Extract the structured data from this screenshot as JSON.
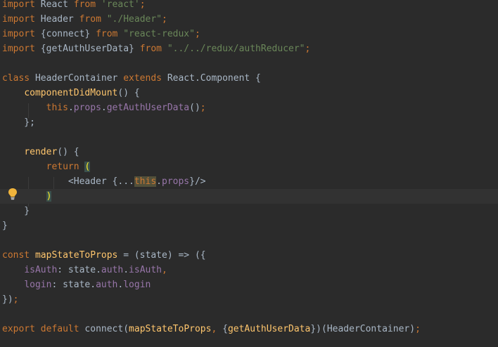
{
  "editor": {
    "lines": [
      [
        {
          "t": "import ",
          "c": "kw"
        },
        {
          "t": "React ",
          "c": "plain"
        },
        {
          "t": "from ",
          "c": "kw"
        },
        {
          "t": "'react'",
          "c": "str"
        },
        {
          "t": ";",
          "c": "kw"
        }
      ],
      [
        {
          "t": "import ",
          "c": "kw"
        },
        {
          "t": "Header ",
          "c": "plain"
        },
        {
          "t": "from ",
          "c": "kw"
        },
        {
          "t": "\"./Header\"",
          "c": "str"
        },
        {
          "t": ";",
          "c": "kw"
        }
      ],
      [
        {
          "t": "import ",
          "c": "kw"
        },
        {
          "t": "{connect} ",
          "c": "plain"
        },
        {
          "t": "from ",
          "c": "kw"
        },
        {
          "t": "\"react-redux\"",
          "c": "str"
        },
        {
          "t": ";",
          "c": "kw"
        }
      ],
      [
        {
          "t": "import ",
          "c": "kw"
        },
        {
          "t": "{getAuthUserData} ",
          "c": "plain"
        },
        {
          "t": "from ",
          "c": "kw"
        },
        {
          "t": "\"../../redux/authReducer\"",
          "c": "str"
        },
        {
          "t": ";",
          "c": "kw"
        }
      ],
      [],
      [
        {
          "t": "class ",
          "c": "kw"
        },
        {
          "t": "HeaderContainer ",
          "c": "plain"
        },
        {
          "t": "extends ",
          "c": "kw"
        },
        {
          "t": "React.Component {",
          "c": "plain"
        }
      ],
      [
        {
          "t": "    ",
          "c": "plain"
        },
        {
          "t": "componentDidMount",
          "c": "fn"
        },
        {
          "t": "() {",
          "c": "plain"
        }
      ],
      [
        {
          "t": "        ",
          "c": "plain"
        },
        {
          "t": "this",
          "c": "kw"
        },
        {
          "t": ".",
          "c": "plain"
        },
        {
          "t": "props",
          "c": "prop"
        },
        {
          "t": ".",
          "c": "plain"
        },
        {
          "t": "getAuthUserData",
          "c": "prop"
        },
        {
          "t": "()",
          "c": "plain"
        },
        {
          "t": ";",
          "c": "kw"
        }
      ],
      [
        {
          "t": "    };",
          "c": "plain"
        }
      ],
      [],
      [
        {
          "t": "    ",
          "c": "plain"
        },
        {
          "t": "render",
          "c": "fn"
        },
        {
          "t": "() {",
          "c": "plain"
        }
      ],
      [
        {
          "t": "        ",
          "c": "plain"
        },
        {
          "t": "return ",
          "c": "kw"
        },
        {
          "t": "(",
          "c": "brace-match"
        }
      ],
      [
        {
          "t": "            ",
          "c": "plain"
        },
        {
          "t": "<",
          "c": "plain"
        },
        {
          "t": "Header ",
          "c": "plain"
        },
        {
          "t": "{...",
          "c": "plain"
        },
        {
          "t": "this",
          "c": "kw this-hl"
        },
        {
          "t": ".",
          "c": "plain"
        },
        {
          "t": "props",
          "c": "prop"
        },
        {
          "t": "}/>",
          "c": "plain"
        }
      ],
      [
        {
          "t": "        ",
          "c": "plain"
        },
        {
          "t": ")",
          "c": "brace-match"
        }
      ],
      [
        {
          "t": "    }",
          "c": "plain"
        }
      ],
      [
        {
          "t": "}",
          "c": "plain"
        }
      ],
      [],
      [
        {
          "t": "const ",
          "c": "kw"
        },
        {
          "t": "mapStateToProps",
          "c": "fn"
        },
        {
          "t": " = (state) => ({",
          "c": "plain"
        }
      ],
      [
        {
          "t": "    ",
          "c": "plain"
        },
        {
          "t": "isAuth",
          "c": "prop"
        },
        {
          "t": ": state.",
          "c": "plain"
        },
        {
          "t": "auth",
          "c": "prop"
        },
        {
          "t": ".",
          "c": "plain"
        },
        {
          "t": "isAuth",
          "c": "prop"
        },
        {
          "t": ",",
          "c": "kw"
        }
      ],
      [
        {
          "t": "    ",
          "c": "plain"
        },
        {
          "t": "login",
          "c": "prop"
        },
        {
          "t": ": state.",
          "c": "plain"
        },
        {
          "t": "auth",
          "c": "prop"
        },
        {
          "t": ".",
          "c": "plain"
        },
        {
          "t": "login",
          "c": "prop"
        }
      ],
      [
        {
          "t": "})",
          "c": "plain"
        },
        {
          "t": ";",
          "c": "kw"
        }
      ],
      [],
      [
        {
          "t": "export ",
          "c": "kw"
        },
        {
          "t": "default ",
          "c": "kw"
        },
        {
          "t": "connect(",
          "c": "plain"
        },
        {
          "t": "mapStateToProps",
          "c": "fn"
        },
        {
          "t": ", ",
          "c": "kw"
        },
        {
          "t": "{",
          "c": "plain"
        },
        {
          "t": "getAuthUserData",
          "c": "fn"
        },
        {
          "t": "})(HeaderContainer)",
          "c": "plain"
        },
        {
          "t": ";",
          "c": "kw"
        }
      ]
    ],
    "current_line_index": 13,
    "intention_icon": "lightbulb-icon"
  },
  "colors": {
    "background": "#2b2b2b",
    "keyword": "#cc7832",
    "string": "#6a8759",
    "function": "#ffc66d",
    "property": "#9876aa",
    "text": "#a9b7c6"
  }
}
